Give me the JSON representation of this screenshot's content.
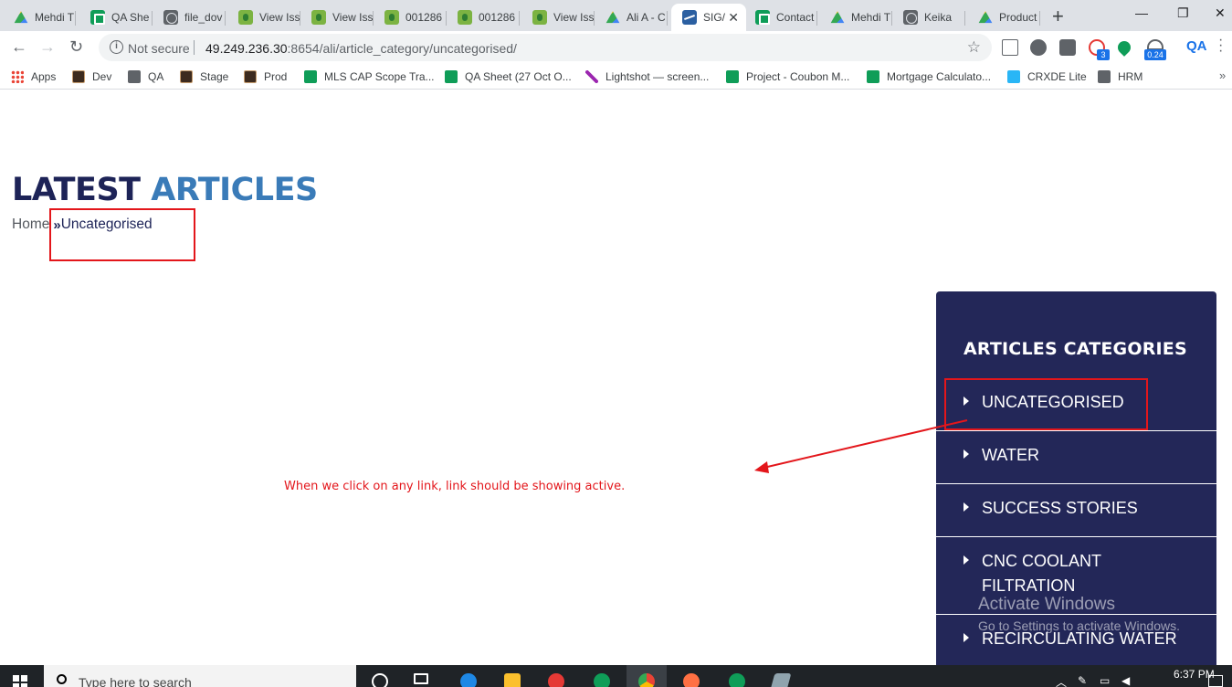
{
  "browser": {
    "tabs": [
      {
        "title": "Mehdi T",
        "icon": "drive-icon",
        "fav": "fav-drive"
      },
      {
        "title": "QA She",
        "icon": "sheets-icon",
        "fav": "fav-sheet"
      },
      {
        "title": "file_dov",
        "icon": "globe-icon",
        "fav": "fav-globe"
      },
      {
        "title": "View Iss",
        "icon": "bug-icon",
        "fav": "fav-bug"
      },
      {
        "title": "View Iss",
        "icon": "bug-icon",
        "fav": "fav-bug"
      },
      {
        "title": "001286",
        "icon": "bug-icon",
        "fav": "fav-bug"
      },
      {
        "title": "001286",
        "icon": "bug-icon",
        "fav": "fav-bug"
      },
      {
        "title": "View Iss",
        "icon": "bug-icon",
        "fav": "fav-bug"
      },
      {
        "title": "Ali A - C",
        "icon": "drive-icon",
        "fav": "fav-drive"
      },
      {
        "title": "SIG/",
        "icon": "sig-icon",
        "fav": "fav-sig",
        "active": true
      },
      {
        "title": "Contact",
        "icon": "sheets-icon",
        "fav": "fav-sheet"
      },
      {
        "title": "Mehdi T",
        "icon": "drive-icon",
        "fav": "fav-drive"
      },
      {
        "title": "Keika",
        "icon": "globe-icon",
        "fav": "fav-globe"
      },
      {
        "title": "Product",
        "icon": "drive-icon",
        "fav": "fav-drive"
      }
    ],
    "new_tab": "+",
    "window_controls": {
      "minimize": "—",
      "restore": "❐",
      "close": "✕"
    },
    "nav": {
      "back": "←",
      "forward": "→",
      "reload": "↻"
    },
    "security_label": "Not secure",
    "info_glyph": "i",
    "url_host": "49.249.236.30",
    "url_path": ":8654/ali/article_category/uncategorised/",
    "star": "☆",
    "extension_badges": {
      "count": "3",
      "speed": "0.24"
    },
    "qa_ext": "QA",
    "bookmarks": [
      {
        "label": "Apps",
        "icon": "apps-grid-icon",
        "cls": "bico-apps"
      },
      {
        "label": "Dev",
        "icon": "aem-icon",
        "cls": "bico-aem"
      },
      {
        "label": "QA",
        "icon": "globe-icon",
        "cls": "bico-globe"
      },
      {
        "label": "Stage",
        "icon": "aem-icon",
        "cls": "bico-aem"
      },
      {
        "label": "Prod",
        "icon": "aem-icon",
        "cls": "bico-aem"
      },
      {
        "label": "MLS CAP Scope Tra...",
        "icon": "sheets-icon",
        "cls": "bico-sheet"
      },
      {
        "label": "QA Sheet (27 Oct O...",
        "icon": "sheets-icon",
        "cls": "bico-sheet"
      },
      {
        "label": "Lightshot — screen...",
        "icon": "feather-icon",
        "cls": "bico-feather"
      },
      {
        "label": "Project - Coubon M...",
        "icon": "sheets-icon",
        "cls": "bico-sheet"
      },
      {
        "label": "Mortgage Calculato...",
        "icon": "sheets-icon",
        "cls": "bico-sheet"
      },
      {
        "label": "CRXDE Lite",
        "icon": "crxde-icon",
        "cls": "bico-crx"
      },
      {
        "label": "HRM",
        "icon": "globe-icon",
        "cls": "bico-globe"
      }
    ],
    "bookmarks_more": "»"
  },
  "page": {
    "heading_word1": "LATEST",
    "heading_word2": "ARTICLES",
    "breadcrumb_home": "Home",
    "breadcrumb_sep": "»",
    "breadcrumb_current": "Uncategorised",
    "annotation_note": "When we click on any link, link should be showing active.",
    "sidebar_title": "ARTICLES CATEGORIES",
    "categories": [
      {
        "label": "Uncategorised"
      },
      {
        "label": "Water"
      },
      {
        "label": "Success Stories"
      },
      {
        "label": "CNC Coolant Filtration"
      },
      {
        "label": "Recirculating Water"
      }
    ],
    "watermark_title": "Activate Windows",
    "watermark_sub": "Go to Settings to activate Windows."
  },
  "taskbar": {
    "search_placeholder": "Type here to search",
    "time": "6:37 PM"
  },
  "colors": {
    "heading_dark": "#1d2357",
    "heading_blue": "#3a7bb8",
    "sidebar_bg": "#232758",
    "annotation_red": "#e3161b"
  }
}
